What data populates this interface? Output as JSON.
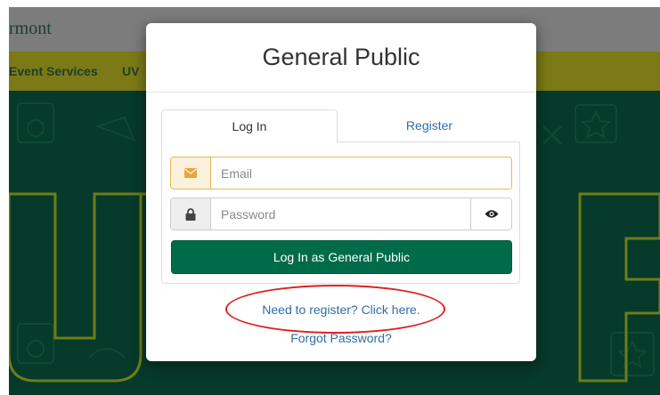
{
  "background": {
    "site_name": "rmont",
    "nav_items": [
      "Event Services",
      "UV"
    ],
    "colors": {
      "header": "#7c7c7c",
      "nav": "#7b7a16",
      "hero": "#063a2a",
      "hero_text": "#6e7d17"
    }
  },
  "modal": {
    "title": "General Public",
    "tabs": [
      {
        "label": "Log In",
        "active": true
      },
      {
        "label": "Register",
        "active": false
      }
    ],
    "email": {
      "placeholder": "Email",
      "icon": "envelope-icon"
    },
    "password": {
      "placeholder": "Password",
      "icon": "lock-icon",
      "toggle_icon": "eye-icon"
    },
    "login_button": "Log In as General Public",
    "register_link": "Need to register? Click here.",
    "forgot_link": "Forgot Password?"
  },
  "colors": {
    "accent": "#006b49",
    "link": "#2f6da8",
    "email_highlight": "#e6b85a",
    "annotation": "#e0201f"
  }
}
